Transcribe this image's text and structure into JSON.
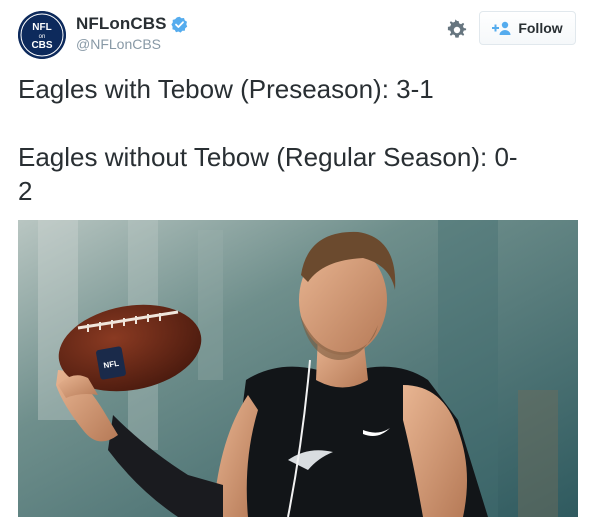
{
  "account": {
    "display_name": "NFLonCBS",
    "handle": "@NFLonCBS",
    "avatar_lines": [
      "NFL",
      "on",
      "CBS"
    ],
    "verified": true
  },
  "actions": {
    "follow_label": "Follow",
    "settings_icon": "gear-icon",
    "follow_icon": "add-user-icon"
  },
  "tweet": {
    "line1": "Eagles with Tebow (Preseason): 3-1",
    "line2": "Eagles without Tebow (Regular Season): 0-",
    "line3": "2"
  },
  "photo": {
    "ball_logo": "NFL",
    "description_hidden": true
  },
  "colors": {
    "text": "#292f33",
    "muted": "#8899a6",
    "verified": "#55acee",
    "follow_icon": "#55acee"
  }
}
